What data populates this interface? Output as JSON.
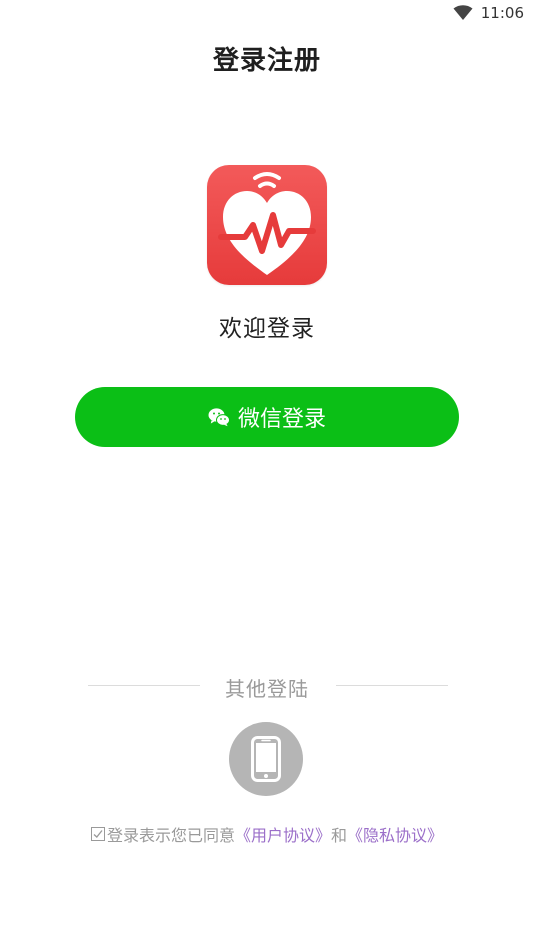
{
  "status_bar": {
    "time": "11:06",
    "wifi_icon": "wifi-icon"
  },
  "header": {
    "title": "登录注册"
  },
  "app": {
    "logo_icon": "heart-pulse-icon",
    "logo_color": "#e63b3b",
    "welcome": "欢迎登录"
  },
  "wechat_login": {
    "label": "微信登录",
    "icon": "wechat-icon",
    "color": "#0bbf16"
  },
  "other_login": {
    "label": "其他登陆",
    "phone_icon": "phone-icon"
  },
  "agreement": {
    "checked": true,
    "prefix": "登录表示您已同意",
    "user_agreement": "《用户协议》",
    "conjunction": "和",
    "privacy_policy": "《隐私协议》",
    "link_color": "#9b6fc9"
  }
}
